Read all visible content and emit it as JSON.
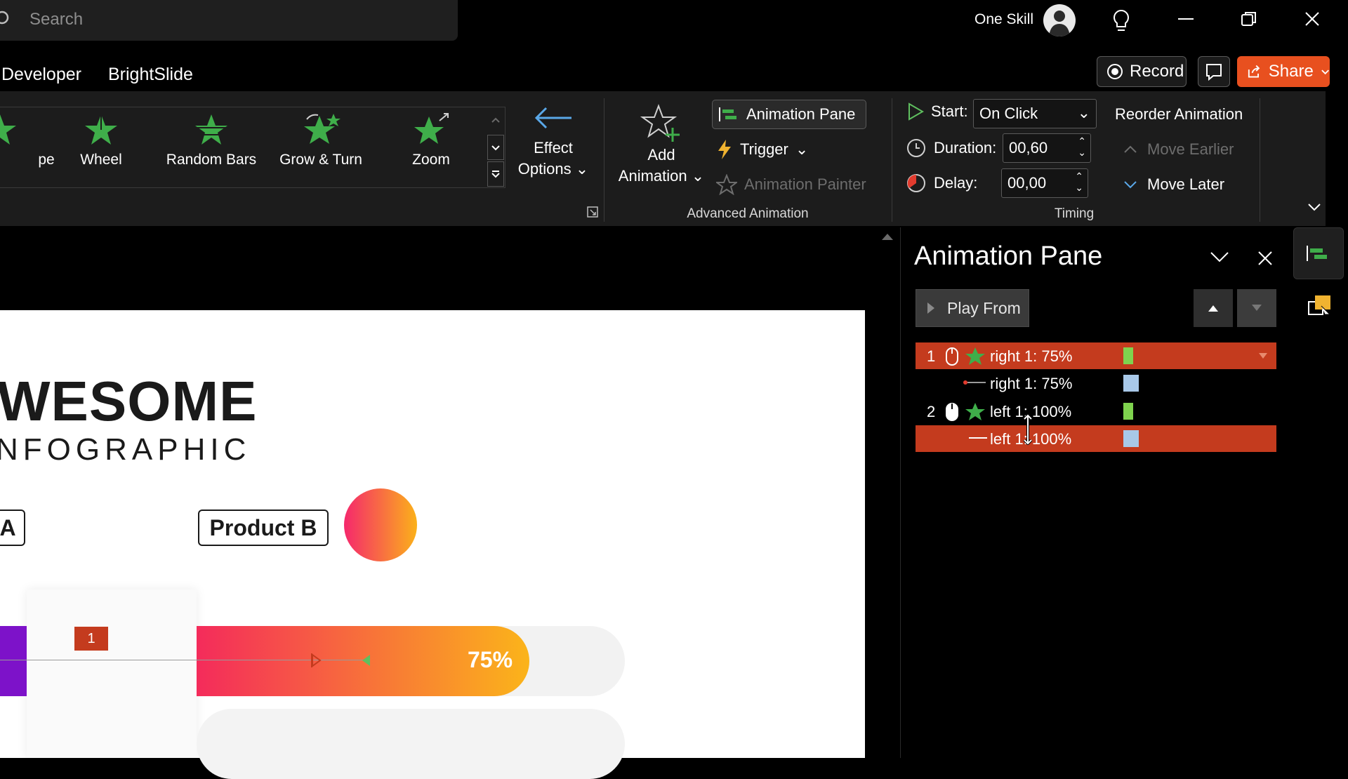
{
  "title_bar": {
    "search_placeholder": "Search",
    "user_name": "One Skill",
    "icons": [
      "search-icon",
      "lightbulb-icon",
      "minimize-icon",
      "restore-icon",
      "close-icon"
    ]
  },
  "ribbon_tabs": [
    "Developer",
    "BrightSlide"
  ],
  "top_actions": {
    "record_label": "Record",
    "share_label": "Share"
  },
  "animation_gallery": {
    "items": [
      {
        "label": "pe",
        "icon": "star-effect-icon"
      },
      {
        "label": "Wheel",
        "icon": "wheel-star-icon"
      },
      {
        "label": "Random Bars",
        "icon": "random-bars-star-icon"
      },
      {
        "label": "Grow & Turn",
        "icon": "grow-turn-star-icon"
      },
      {
        "label": "Zoom",
        "icon": "zoom-star-icon"
      }
    ]
  },
  "effect_options": {
    "line1": "Effect",
    "line2": "Options"
  },
  "advanced_animation": {
    "add_animation_line1": "Add",
    "add_animation_line2": "Animation",
    "animation_pane_label": "Animation Pane",
    "trigger_label": "Trigger",
    "animation_painter_label": "Animation Painter",
    "group_label": "Advanced Animation"
  },
  "timing": {
    "start_label": "Start:",
    "start_value": "On Click",
    "duration_label": "Duration:",
    "duration_value": "00,60",
    "delay_label": "Delay:",
    "delay_value": "00,00",
    "reorder_label": "Reorder Animation",
    "move_earlier_label": "Move Earlier",
    "move_later_label": "Move Later",
    "group_label": "Timing"
  },
  "slide": {
    "title": "WESOME",
    "subtitle": "NFOGRAPHIC",
    "label_a": "A",
    "label_product_b": "Product B",
    "bar_percent": "75%",
    "bar_fill_fraction": 0.75,
    "animation_tag": "1",
    "colors": {
      "purple": "#7d12c9",
      "gradient_start": "#f42b5b",
      "gradient_end": "#fbb41a"
    }
  },
  "animation_pane": {
    "title": "Animation Pane",
    "play_from_label": "Play From",
    "rows": [
      {
        "num": "1",
        "label": "right 1: 75%",
        "selected": true,
        "trigger": "on-click"
      },
      {
        "num": "",
        "label": "right 1: 75%",
        "selected": false,
        "trigger": "with-previous"
      },
      {
        "num": "2",
        "label": "left 1: 100%",
        "selected": false,
        "trigger": "on-click"
      },
      {
        "num": "",
        "label": "left 1: 100%",
        "selected": true,
        "trigger": "with-previous"
      }
    ]
  },
  "accent_colors": {
    "share": "#e8501f",
    "selection": "#c43b1e",
    "effect_green": "#3fae4a"
  }
}
